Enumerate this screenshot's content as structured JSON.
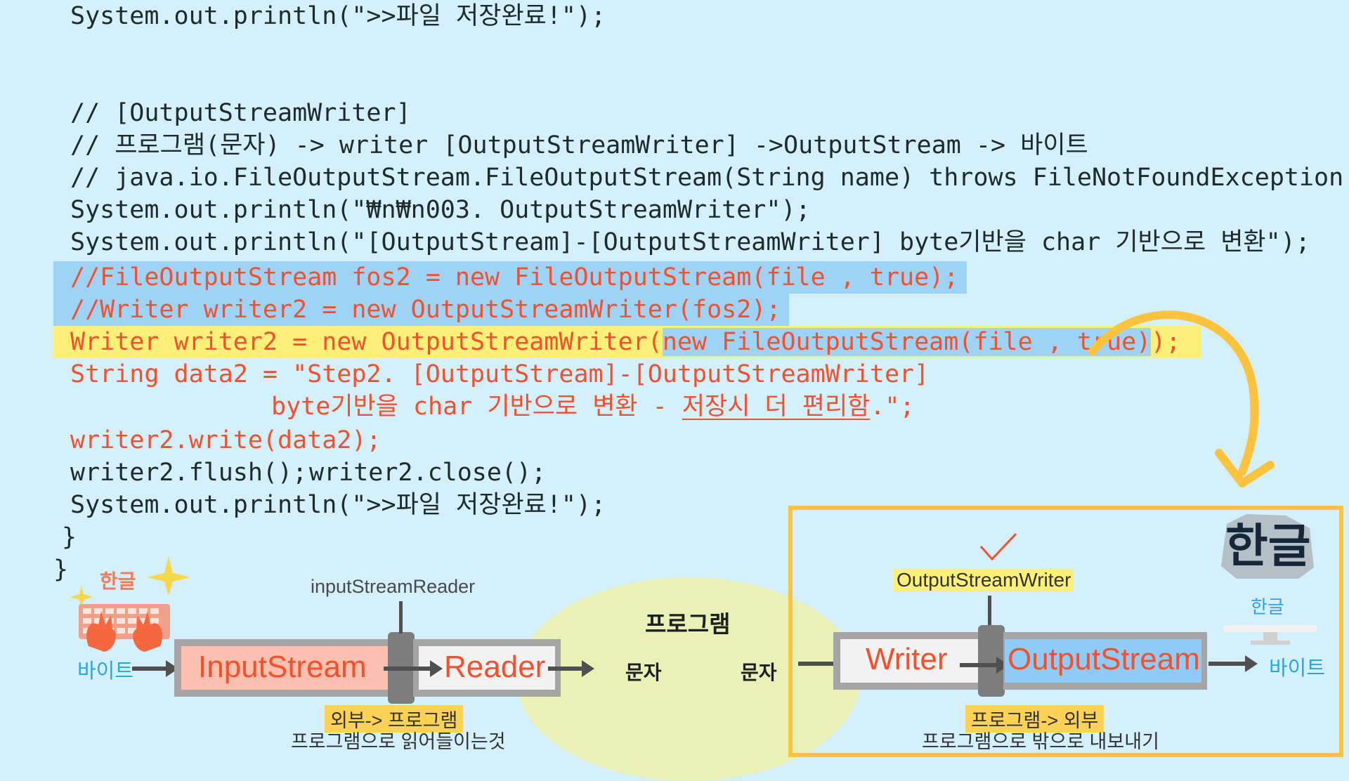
{
  "code": {
    "line_print_done_top": "System.out.println(\">>파일 저장완료!\");",
    "comment_header": "// [OutputStreamWriter]",
    "comment_flow": "// 프로그램(문자) -> writer [OutputStreamWriter] ->OutputStream -> 바이트",
    "comment_ctor": "// java.io.FileOutputStream.FileOutputStream(String name) throws FileNotFoundException",
    "print_section": "System.out.println(\"₩n₩n003. OutputStreamWriter\");",
    "print_desc": "System.out.println(\"[OutputStream]-[OutputStreamWriter] byte기반을 char 기반으로 변환\");",
    "commented_fos2": "//FileOutputStream fos2 = new FileOutputStream(file , true);",
    "commented_writer2": "//Writer writer2 = new OutputStreamWriter(fos2);",
    "writer2_decl_a": "Writer writer2 = new OutputStreamWriter(",
    "writer2_decl_b": "new FileOutputStream(file , true)",
    "writer2_decl_c": ");",
    "data2_line1": "String data2 = \"Step2. [OutputStream]-[OutputStreamWriter]",
    "data2_line2_a": "byte기반을 char 기반으로 변환 - ",
    "data2_line2_b": "저장시 더 편리함",
    "data2_line2_c": ".\";",
    "write_call": "writer2.write(data2);",
    "flush_call": "writer2.flush();",
    "close_call": "writer2.close();",
    "print_done": "System.out.println(\">>파일 저장완료!\");",
    "brace_inner": "}",
    "brace_outer": "}"
  },
  "diagram_left": {
    "hangul_label": "한글",
    "byte_label": "바이트",
    "inputstream_label": "InputStream",
    "reader_label": "Reader",
    "isr_label": "inputStreamReader",
    "char_label": "문자",
    "caption_title": "외부-> 프로그램",
    "caption_desc": "프로그램으로 읽어들이는것"
  },
  "program_label": "프로그램",
  "diagram_right": {
    "char_label": "문자",
    "osw_label": "OutputStreamWriter",
    "writer_label": "Writer",
    "outputstream_label": "OutputStream",
    "byte_label": "바이트",
    "hangul_big": "한글",
    "hangul_small": "한글",
    "caption_title": "프로그램-> 외부",
    "caption_desc": "프로그램으로 밖으로 내보내기"
  },
  "colors": {
    "background": "#d3f0fc",
    "code_red": "#f4502c",
    "highlight_blue": "#9fd2f7",
    "highlight_yellow": "#fdf078",
    "frame_orange": "#fcc43e",
    "byte_blue": "#2aa4e8"
  }
}
